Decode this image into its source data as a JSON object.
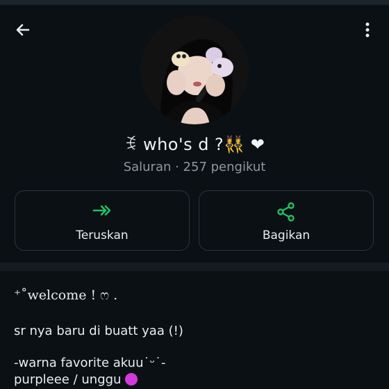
{
  "header": {
    "back_icon": "arrow-left-icon",
    "menu_icon": "more-vertical-icon"
  },
  "channel": {
    "name": "ꉂ who's d ?👯‍♀️ ❤︎",
    "meta": "Saluran · 257 pengikut",
    "avatar_alt": "profile photo"
  },
  "actions": [
    {
      "label": "Teruskan",
      "icon": "forward-icon"
    },
    {
      "label": "Bagikan",
      "icon": "share-icon"
    }
  ],
  "description": {
    "welcome": "⁺˚welcome ! ෆ .",
    "line2": "sr nya baru di buatt yaa (!)",
    "line3": "-warna favorite akuu˙ᵕ˙-",
    "line4": "purpleee / unggu"
  },
  "colors": {
    "background": "#0b1014",
    "accent_green": "#21c063",
    "muted_text": "#8d989f",
    "purple_dot": "#d43ad9"
  }
}
